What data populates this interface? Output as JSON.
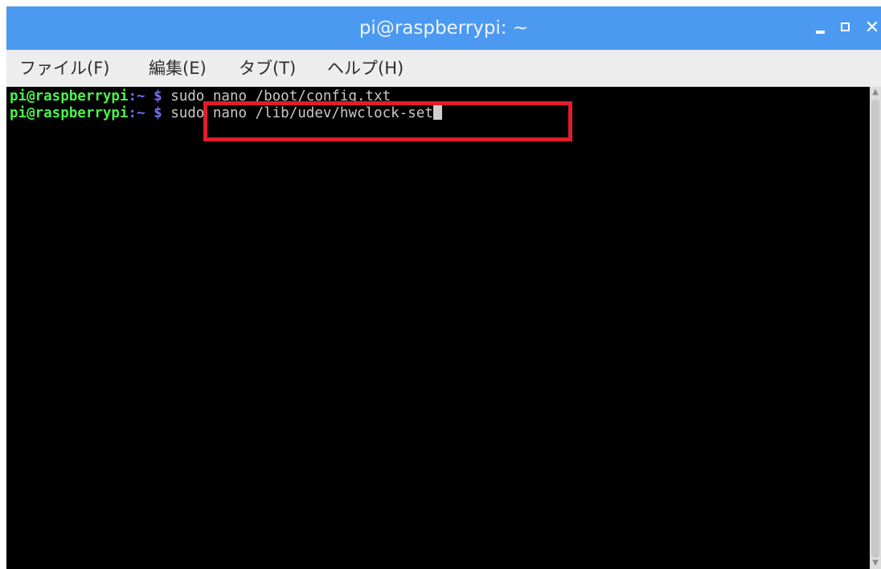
{
  "window": {
    "title": "pi@raspberrypi: ~",
    "minimize_label": "_",
    "maximize_label": "□",
    "close_label": "✕"
  },
  "menu": {
    "items": [
      {
        "label": "ファイル(F)"
      },
      {
        "label": "編集(E)"
      },
      {
        "label": "タブ(T)"
      },
      {
        "label": "ヘルプ(H)"
      }
    ]
  },
  "terminal": {
    "lines": [
      {
        "user_host": "pi@raspberrypi",
        "path": ":~ $ ",
        "command": "sudo nano /boot/config.txt"
      },
      {
        "user_host": "pi@raspberrypi",
        "path": ":~ $ ",
        "command": "sudo nano /lib/udev/hwclock-set"
      }
    ]
  },
  "colors": {
    "titlebar": "#4b99f1",
    "prompt_user": "#4cf04c",
    "prompt_path": "#6f6ff7",
    "command_text": "#c9c9c9",
    "highlight_border": "#e11d2a",
    "terminal_bg": "#000000"
  },
  "icons": {
    "minimize": "minimize-icon",
    "maximize": "maximize-icon",
    "close": "close-icon",
    "scroll_up": "scroll-up-arrow-icon",
    "scroll_down": "scroll-down-arrow-icon"
  }
}
